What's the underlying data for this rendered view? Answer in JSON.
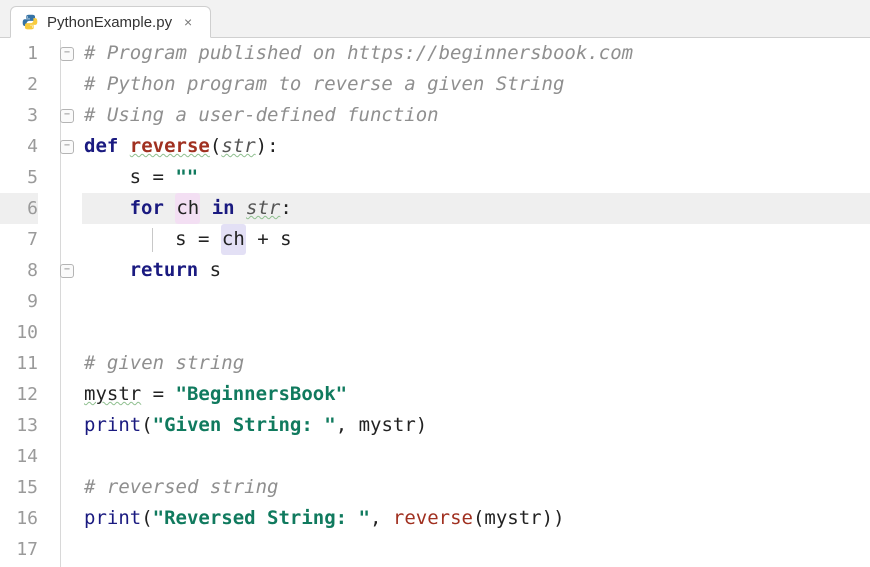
{
  "tab": {
    "filename": "PythonExample.py"
  },
  "line_numbers": [
    "1",
    "2",
    "3",
    "4",
    "5",
    "6",
    "7",
    "8",
    "9",
    "10",
    "11",
    "12",
    "13",
    "14",
    "15",
    "16",
    "17"
  ],
  "highlighted_line_index": 5,
  "fold_markers_at": [
    0,
    2,
    3,
    7
  ],
  "code": {
    "l1": {
      "c1": "# Program published on https://beginnersbook.com"
    },
    "l2": {
      "c1": "# Python program to reverse a given String"
    },
    "l3": {
      "c1": "# Using a user-defined function"
    },
    "l4": {
      "def": "def",
      "name": "reverse",
      "lp": "(",
      "param": "str",
      "rp": ")",
      "colon": ":"
    },
    "l5": {
      "id": "s",
      "eq": " = ",
      "str": "\"\""
    },
    "l6": {
      "for": "for",
      "ch": "ch",
      "in": "in",
      "str": "str",
      "colon": ":"
    },
    "l7": {
      "id": "s",
      "eq": " = ",
      "ch": "ch",
      "plus": " + ",
      "s2": "s"
    },
    "l8": {
      "ret": "return",
      "id": " s"
    },
    "l11": {
      "c1": "# given string"
    },
    "l12": {
      "id": "mystr",
      "eq": " = ",
      "str": "\"BeginnersBook\""
    },
    "l13": {
      "fn": "print",
      "lp": "(",
      "str": "\"Given String: \"",
      "comma": ", ",
      "arg": "mystr",
      "rp": ")"
    },
    "l15": {
      "c1": "# reversed string"
    },
    "l16": {
      "fn": "print",
      "lp": "(",
      "str": "\"Reversed String: \"",
      "comma": ", ",
      "call": "reverse",
      "lp2": "(",
      "arg": "mystr",
      "rp2": ")",
      "rp": ")"
    }
  }
}
